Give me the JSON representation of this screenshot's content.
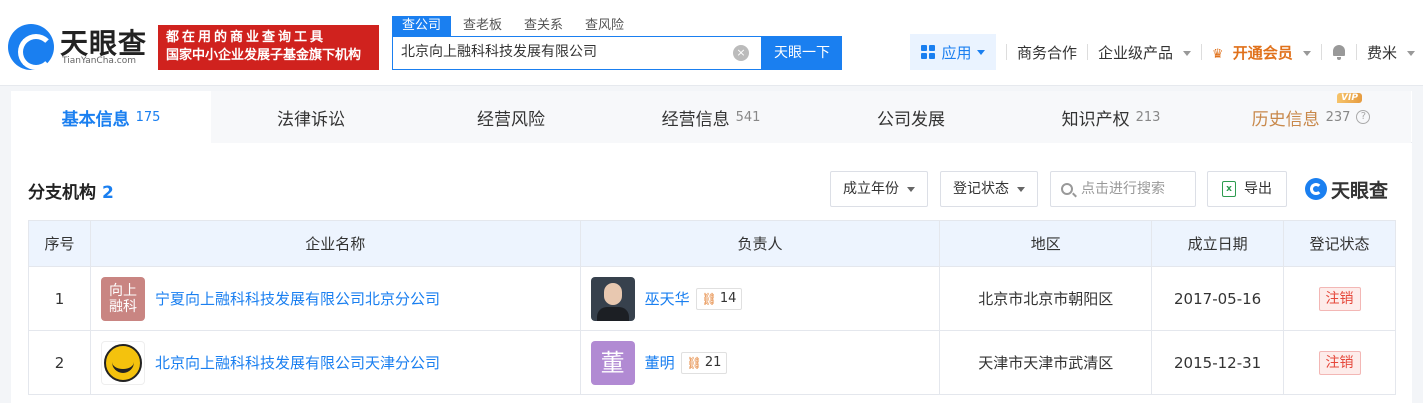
{
  "header": {
    "logo_cn": "天眼查",
    "logo_en": "TianYanCha.com",
    "slogan_line1": "都在用的商业查询工具",
    "slogan_line2": "国家中小企业发展子基金旗下机构",
    "search_tabs": [
      "查公司",
      "查老板",
      "查关系",
      "查风险"
    ],
    "search_value": "北京向上融科科技发展有限公司",
    "search_button": "天眼一下",
    "clear_symbol": "×",
    "nav": {
      "app": "应用",
      "business": "商务合作",
      "enterprise": "企业级产品",
      "vip": "开通会员",
      "user": "费米"
    }
  },
  "tabs": [
    {
      "label": "基本信息",
      "count": "175"
    },
    {
      "label": "法律诉讼",
      "count": ""
    },
    {
      "label": "经营风险",
      "count": ""
    },
    {
      "label": "经营信息",
      "count": "541"
    },
    {
      "label": "公司发展",
      "count": ""
    },
    {
      "label": "知识产权",
      "count": "213"
    },
    {
      "label": "历史信息",
      "count": "237",
      "badge": "VIP",
      "help": "?"
    }
  ],
  "section": {
    "title": "分支机构",
    "count": "2",
    "filter_year": "成立年份",
    "filter_status": "登记状态",
    "search_placeholder": "点击进行搜索",
    "export": "导出",
    "brand": "天眼查"
  },
  "table": {
    "headers": [
      "序号",
      "企业名称",
      "负责人",
      "地区",
      "成立日期",
      "登记状态"
    ],
    "rows": [
      {
        "no": "1",
        "logo_text": "向上融科",
        "name": "宁夏向上融科科技发展有限公司北京分公司",
        "person": "巫天华",
        "relations": "14",
        "region": "北京市北京市朝阳区",
        "date": "2017-05-16",
        "status": "注销"
      },
      {
        "no": "2",
        "logo_text": "",
        "name": "北京向上融科科技发展有限公司天津分公司",
        "person": "董明",
        "avatar_char": "董",
        "relations": "21",
        "region": "天津市天津市武清区",
        "date": "2015-12-31",
        "status": "注销"
      }
    ]
  },
  "colors": {
    "accent": "#1a7ff0",
    "slogan_bg": "#d0221e",
    "vip": "#e0711b",
    "status_red": "#e5483b"
  }
}
